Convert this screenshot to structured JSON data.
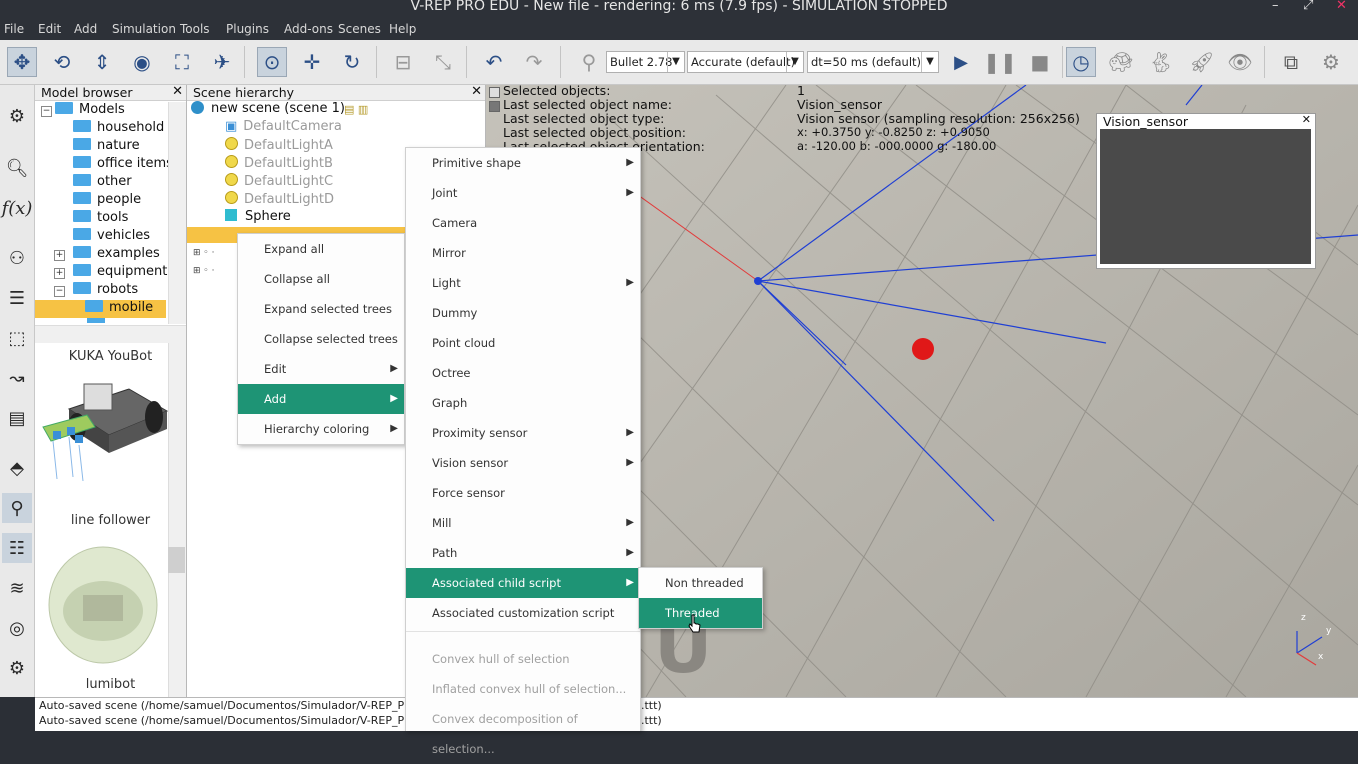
{
  "window": {
    "title": "V-REP PRO EDU - New file - rendering: 6 ms (7.9 fps) - SIMULATION STOPPED",
    "minimize": "–",
    "restore": "⤢",
    "close": "✕"
  },
  "menubar": [
    "File",
    "Edit",
    "Add",
    "Simulation",
    "Tools",
    "Plugins",
    "Add-ons",
    "Scenes",
    "Help"
  ],
  "toolbar": {
    "engine": "Bullet 2.78",
    "accuracy": "Accurate (default)",
    "timestep": "dt=50 ms (default)"
  },
  "model_browser": {
    "title": "Model browser",
    "root": "Models",
    "folders": [
      "household",
      "nature",
      "office items",
      "other",
      "people",
      "tools",
      "vehicles",
      "examples",
      "equipment",
      "robots",
      "mobile"
    ],
    "thumbs": [
      "KUKA YouBot",
      "line follower",
      "lumibot"
    ]
  },
  "scene_hierarchy": {
    "title": "Scene hierarchy",
    "scene": "new scene (scene 1)",
    "items": [
      "DefaultCamera",
      "DefaultLightA",
      "DefaultLightB",
      "DefaultLightC",
      "DefaultLightD",
      "Sphere"
    ]
  },
  "info_overlay": {
    "labels": [
      "Selected objects:",
      "Last selected object name:",
      "Last selected object type:",
      "Last selected object position:",
      "Last selected object orientation:"
    ],
    "values": [
      "1",
      "Vision_sensor",
      "Vision sensor (sampling resolution: 256x256)",
      "x: +0.3750    y: -0.8250    z: +0.9050",
      "a: -120.00    b: -000.0000    g: -180.00"
    ]
  },
  "vision_window": {
    "title": "Vision_sensor",
    "close": "✕"
  },
  "context_menu_1": [
    "Expand all",
    "Collapse all",
    "Expand selected trees",
    "Collapse selected trees",
    "Edit",
    "Add",
    "Hierarchy coloring"
  ],
  "context_menu_2": [
    "Primitive shape",
    "Joint",
    "Camera",
    "Mirror",
    "Light",
    "Dummy",
    "Point cloud",
    "Octree",
    "Graph",
    "Proximity sensor",
    "Vision sensor",
    "Force sensor",
    "Mill",
    "Path",
    "Associated child script",
    "Associated customization script",
    "Convex hull of selection",
    "Inflated convex hull of selection...",
    "Convex decomposition of selection..."
  ],
  "context_menu_3": [
    "Non threaded",
    "Threaded"
  ],
  "status": {
    "line1": "Auto-saved scene (/home/samuel/Documentos/Simulador/V-REP_PRO_EDU",
    "line2": "Auto-saved scene (/home/samuel/Documentos/Simulador/V-REP_PRO_EDU",
    "tail": ".ttt)"
  },
  "axes": {
    "x": "x",
    "y": "y",
    "z": "z"
  },
  "colors": {
    "menu_highlight": "#1e9475",
    "accent": "#2c4f86",
    "folder": "#4aa8e6",
    "selection": "#f6c244"
  }
}
